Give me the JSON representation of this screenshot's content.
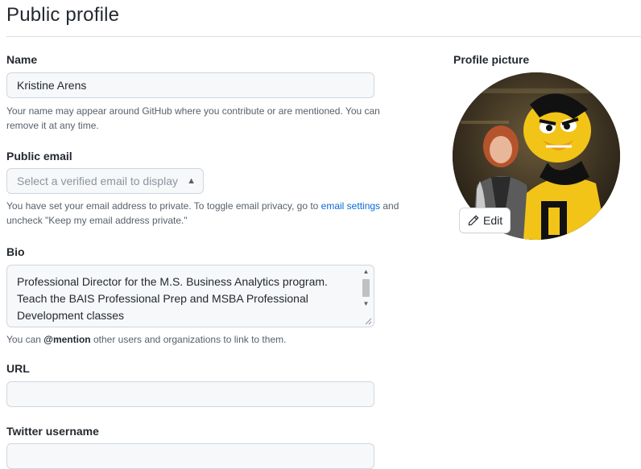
{
  "page": {
    "title": "Public profile"
  },
  "name": {
    "label": "Name",
    "value": "Kristine Arens",
    "note": "Your name may appear around GitHub where you contribute or are mentioned. You can remove it at any time."
  },
  "public_email": {
    "label": "Public email",
    "selected": "Select a verified email to display",
    "note_before": "You have set your email address to private. To toggle email privacy, go to ",
    "link": "email settings",
    "note_after": " and uncheck \"Keep my email address private.\""
  },
  "bio": {
    "label": "Bio",
    "value": "Professional Director for the M.S. Business Analytics program. Teach the BAIS Professional Prep and MSBA Professional Development classes",
    "note_before": "You can ",
    "note_mention": "@mention",
    "note_after": " other users and organizations to link to them."
  },
  "url": {
    "label": "URL",
    "value": ""
  },
  "twitter": {
    "label": "Twitter username",
    "value": ""
  },
  "profile_picture": {
    "label": "Profile picture",
    "edit_label": "Edit"
  },
  "colors": {
    "link": "#0969da",
    "border": "#d0d7de",
    "input_bg": "#f6f8fa",
    "muted_text": "#57606a"
  }
}
